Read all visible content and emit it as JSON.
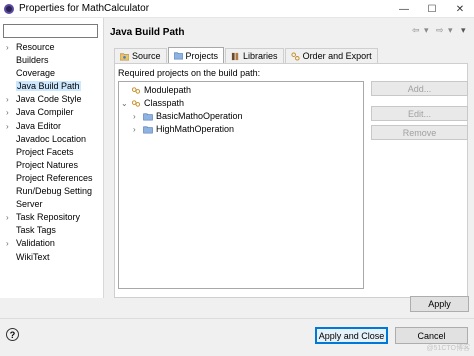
{
  "window": {
    "title": "Properties for MathCalculator",
    "controls": {
      "minimize": "—",
      "maximize": "☐",
      "close": "✕"
    }
  },
  "sidebar": {
    "filter_value": "",
    "items": [
      {
        "label": "Resource",
        "expandable": true
      },
      {
        "label": "Builders",
        "expandable": false
      },
      {
        "label": "Coverage",
        "expandable": false
      },
      {
        "label": "Java Build Path",
        "expandable": false,
        "selected": true
      },
      {
        "label": "Java Code Style",
        "expandable": true
      },
      {
        "label": "Java Compiler",
        "expandable": true
      },
      {
        "label": "Java Editor",
        "expandable": true
      },
      {
        "label": "Javadoc Location",
        "expandable": false
      },
      {
        "label": "Project Facets",
        "expandable": false
      },
      {
        "label": "Project Natures",
        "expandable": false
      },
      {
        "label": "Project References",
        "expandable": false
      },
      {
        "label": "Run/Debug Setting",
        "expandable": false
      },
      {
        "label": "Server",
        "expandable": false
      },
      {
        "label": "Task Repository",
        "expandable": true
      },
      {
        "label": "Task Tags",
        "expandable": false
      },
      {
        "label": "Validation",
        "expandable": true
      },
      {
        "label": "WikiText",
        "expandable": false
      }
    ]
  },
  "main": {
    "heading": "Java Build Path",
    "history": {
      "back": "⇦",
      "forward": "⇨",
      "menu": "▾"
    },
    "tabs": [
      {
        "label": "Source",
        "icon": "source-folder-icon"
      },
      {
        "label": "Projects",
        "icon": "projects-icon",
        "active": true
      },
      {
        "label": "Libraries",
        "icon": "libraries-icon"
      },
      {
        "label": "Order and Export",
        "icon": "order-export-icon"
      }
    ],
    "required_label": "Required projects on the build path:",
    "tree": {
      "modulepath": "Modulepath",
      "classpath": "Classpath",
      "projects": [
        "BasicMathoOperation",
        "HighMathOperation"
      ]
    },
    "buttons": {
      "add": "Add...",
      "edit": "Edit...",
      "remove": "Remove"
    }
  },
  "footer": {
    "apply": "Apply",
    "help": "?",
    "apply_and_close": "Apply and Close",
    "cancel": "Cancel",
    "watermark": "@51CTO博客"
  },
  "colors": {
    "selection": "#cce8ff",
    "default_button_border": "#0078d7"
  }
}
